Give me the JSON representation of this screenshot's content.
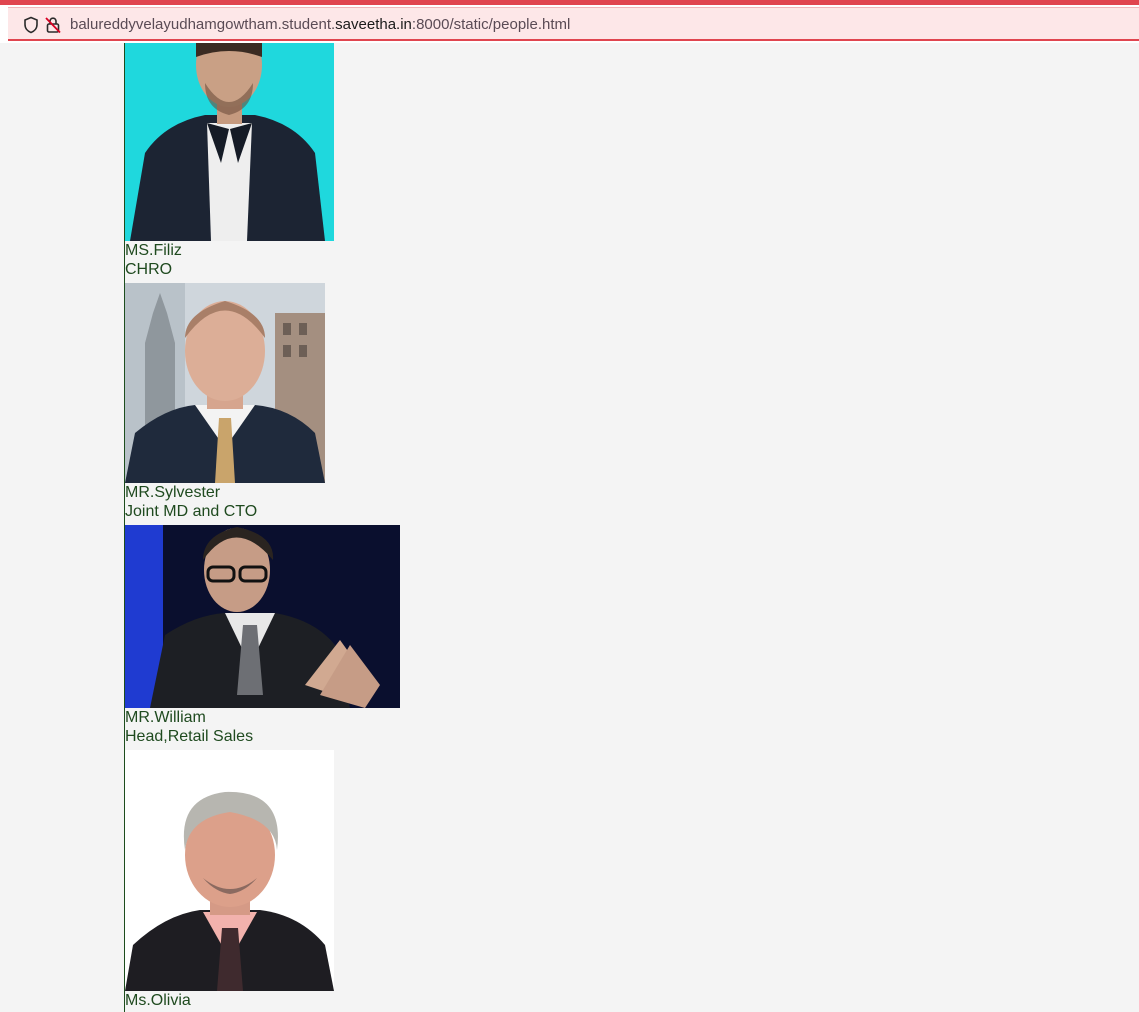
{
  "browser": {
    "url_prefix": "balureddyvelayudhamgowtham.student.",
    "url_domain": "saveetha.in",
    "url_suffix": ":8000/static/people.html"
  },
  "people": [
    {
      "name": "MS.Filiz",
      "title": "CHRO"
    },
    {
      "name": "MR.Sylvester",
      "title": "Joint MD and CTO"
    },
    {
      "name": "MR.William",
      "title": "Head,Retail Sales"
    },
    {
      "name": "Ms.Olivia",
      "title": ""
    }
  ]
}
